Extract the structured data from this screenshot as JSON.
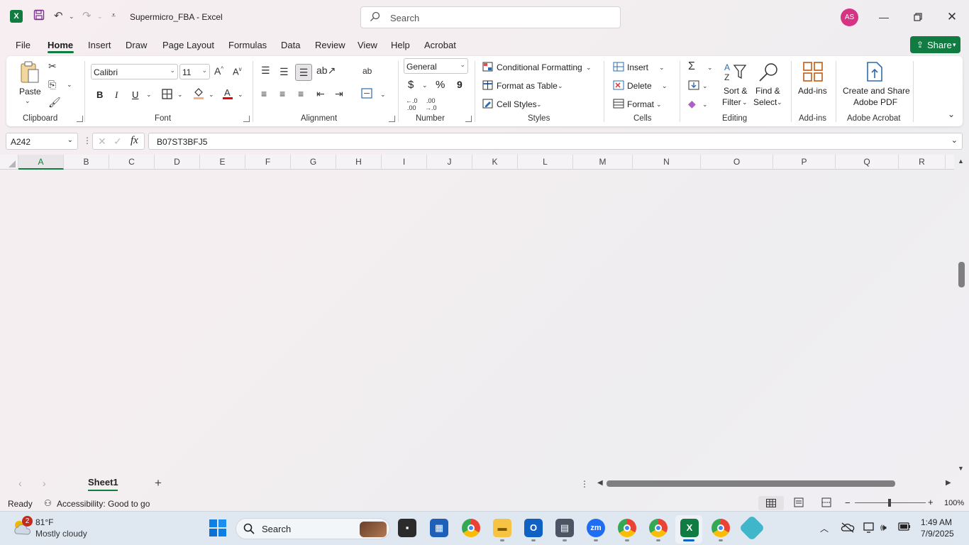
{
  "titlebar": {
    "doc_title": "Supermicro_FBA  -  Excel",
    "search_placeholder": "Search",
    "avatar_initials": "AS"
  },
  "menu": {
    "tabs": [
      "File",
      "Home",
      "Insert",
      "Draw",
      "Page Layout",
      "Formulas",
      "Data",
      "Review",
      "View",
      "Help",
      "Acrobat"
    ],
    "active_tab": "Home",
    "share_label": "Share"
  },
  "ribbon": {
    "clipboard": {
      "paste_label": "Paste",
      "group_label": "Clipboard"
    },
    "font": {
      "font_name": "Calibri",
      "font_size": "11",
      "bold": "B",
      "italic": "I",
      "underline": "U",
      "group_label": "Font"
    },
    "alignment": {
      "group_label": "Alignment"
    },
    "number": {
      "format": "General",
      "currency": "$",
      "percent": "%",
      "comma": "9",
      "group_label": "Number"
    },
    "styles": {
      "conditional_formatting": "Conditional Formatting",
      "format_as_table": "Format as Table",
      "cell_styles": "Cell Styles",
      "group_label": "Styles"
    },
    "cells": {
      "insert": "Insert",
      "delete": "Delete",
      "format": "Format",
      "group_label": "Cells"
    },
    "editing": {
      "sort_filter_1": "Sort &",
      "sort_filter_2": "Filter",
      "find_select_1": "Find &",
      "find_select_2": "Select",
      "group_label": "Editing"
    },
    "addins": {
      "label": "Add-ins",
      "group_label": "Add-ins"
    },
    "acrobat": {
      "label_1": "Create and Share",
      "label_2": "Adobe PDF",
      "group_label": "Adobe Acrobat"
    }
  },
  "formula_bar": {
    "name_box": "A242",
    "formula": "B07ST3BFJ5"
  },
  "grid": {
    "columns": [
      "A",
      "B",
      "C",
      "D",
      "E",
      "F",
      "G",
      "H",
      "I",
      "J",
      "K",
      "L",
      "M",
      "N",
      "O",
      "P",
      "Q",
      "R"
    ],
    "selected_column": "A"
  },
  "sheets": {
    "tabs": [
      "Sheet1"
    ],
    "active": "Sheet1"
  },
  "status": {
    "ready": "Ready",
    "accessibility": "Accessibility: Good to go",
    "zoom": "100%"
  },
  "taskbar": {
    "weather_temp": "81°F",
    "weather_desc": "Mostly cloudy",
    "weather_badge": "2",
    "search_label": "Search",
    "time": "1:49 AM",
    "date": "7/9/2025"
  },
  "colors": {
    "accent": "#107c41",
    "avatar": "#d63384"
  }
}
